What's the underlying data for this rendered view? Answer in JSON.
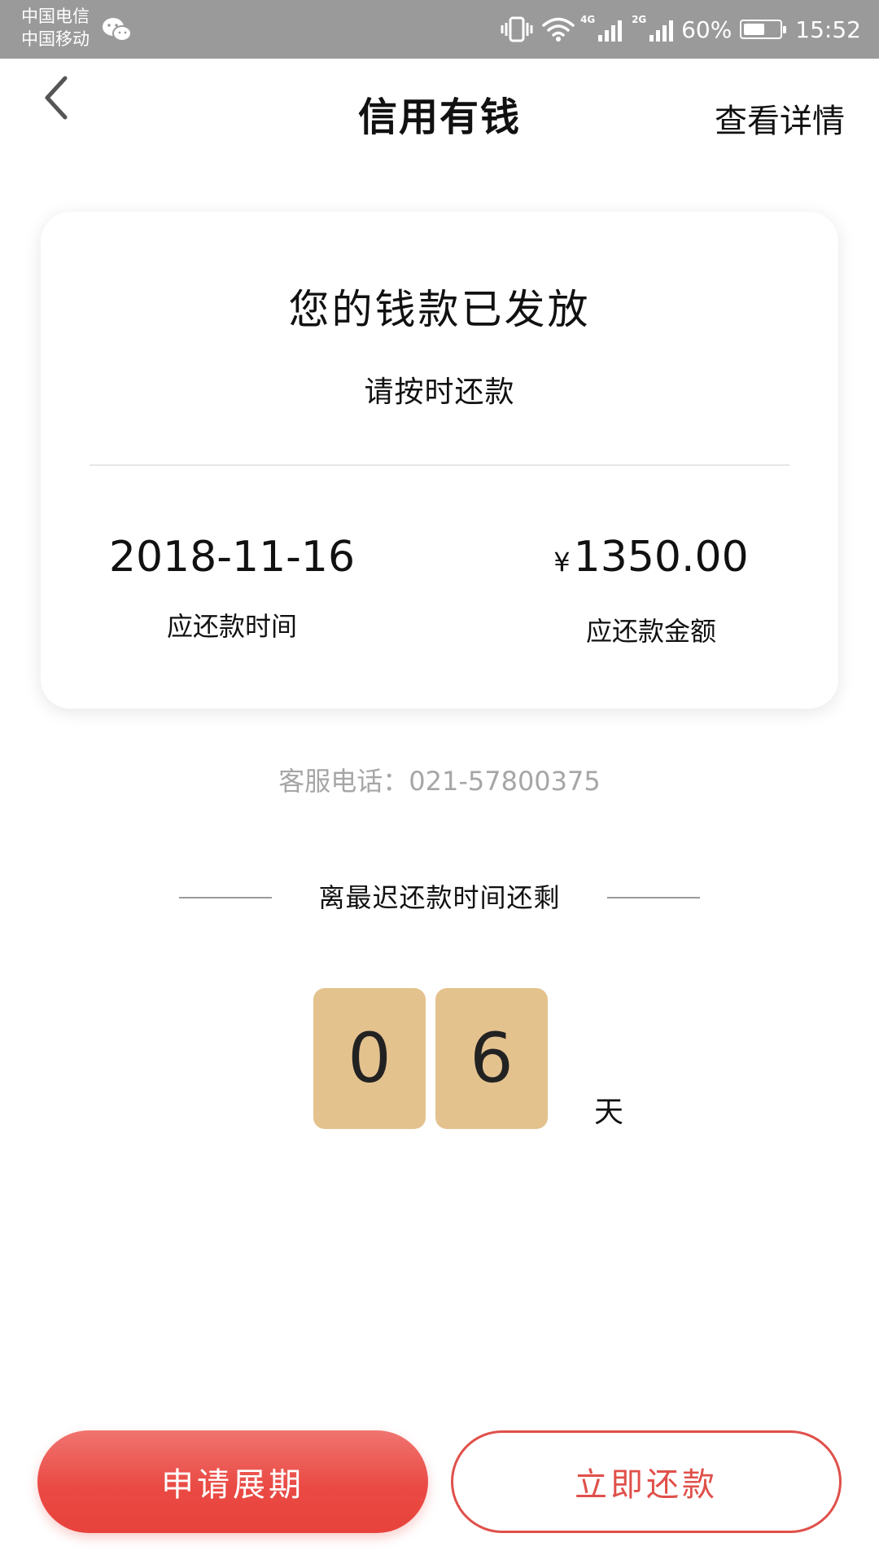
{
  "status_bar": {
    "carrier_1": "中国电信",
    "carrier_2": "中国移动",
    "network_1": "4G",
    "network_2": "2G",
    "battery": "60%",
    "battery_level": 0.6,
    "time": "15:52"
  },
  "header": {
    "title": "信用有钱",
    "detail_link": "查看详情"
  },
  "card": {
    "title": "您的钱款已发放",
    "subtitle": "请按时还款",
    "due_date": "2018-11-16",
    "due_date_label": "应还款时间",
    "currency_symbol": "¥",
    "amount": "1350.00",
    "amount_label": "应还款金额"
  },
  "service": {
    "phone_text": "客服电话：021-57800375"
  },
  "countdown": {
    "heading": "离最迟还款时间还剩",
    "digit_1": "0",
    "digit_2": "6",
    "unit": "天"
  },
  "buttons": {
    "extend_label": "申请展期",
    "repay_label": "立即还款"
  },
  "colors": {
    "accent_red": "#e8423c",
    "countdown_box": "#e4c28e",
    "status_bar": "#9a9a9a"
  },
  "icons": {
    "back": "chevron-left-icon",
    "wechat": "wechat-icon",
    "vibrate": "vibrate-icon",
    "wifi": "wifi-icon",
    "signal": "signal-icon",
    "battery": "battery-icon"
  }
}
